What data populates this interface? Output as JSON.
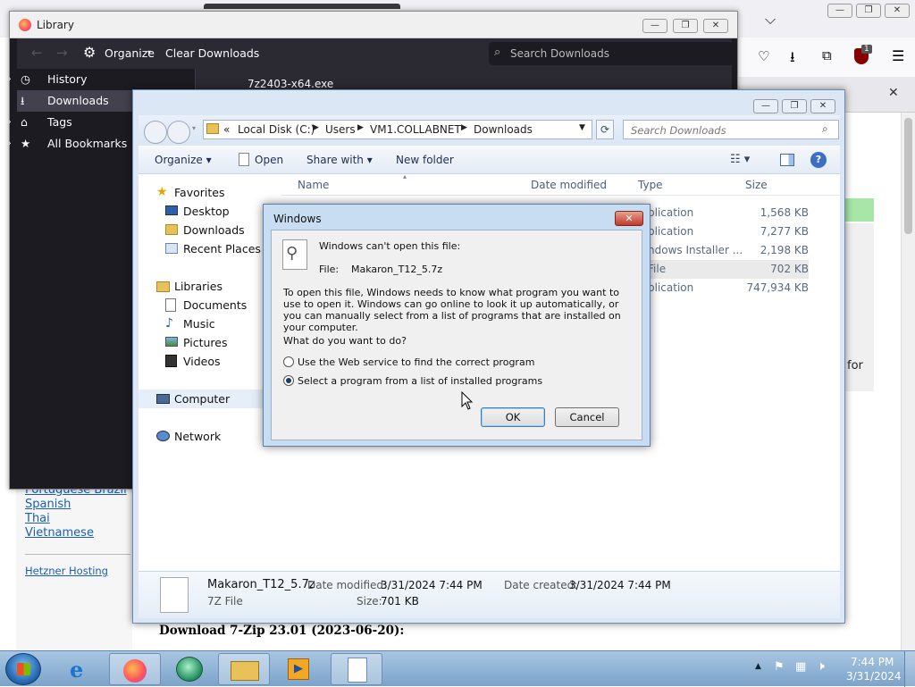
{
  "firefox": {
    "page_links": [
      "Portuguese Brazil",
      "Spanish",
      "Thai",
      "Vietnamese"
    ],
    "hosting_link": "Hetzner Hosting",
    "download_heading": "Download 7-Zip 23.01 (2023-06-20):",
    "badge_count": "1",
    "for_text": "for",
    "close_glyph": "✕"
  },
  "library": {
    "title": "Library",
    "toolbar": {
      "organize": "Organize",
      "clear": "Clear Downloads",
      "search_placeholder": "Search Downloads"
    },
    "sidebar": [
      "History",
      "Downloads",
      "Tags",
      "All Bookmarks"
    ],
    "first_download": "7z2403-x64.exe"
  },
  "explorer": {
    "breadcrumb": [
      "Local Disk (C:)",
      "Users",
      "VM1.COLLABNET",
      "Downloads"
    ],
    "crumb_prefix": "«",
    "search_placeholder": "Search Downloads",
    "commands": {
      "organize": "Organize",
      "open": "Open",
      "share": "Share with",
      "newfolder": "New folder"
    },
    "nav": {
      "favorites": "Favorites",
      "favorites_items": [
        "Desktop",
        "Downloads",
        "Recent Places"
      ],
      "libraries": "Libraries",
      "libraries_items": [
        "Documents",
        "Music",
        "Pictures",
        "Videos"
      ],
      "computer": "Computer",
      "network": "Network"
    },
    "columns": [
      "Name",
      "Date modified",
      "Type",
      "Size"
    ],
    "rows": [
      {
        "type": "plication",
        "size": "1,568 KB"
      },
      {
        "type": "plication",
        "size": "7,277 KB"
      },
      {
        "type": "ndows Installer ...",
        "size": "2,198 KB"
      },
      {
        "type": "File",
        "size": "702 KB"
      },
      {
        "type": "plication",
        "size": "747,934 KB"
      }
    ],
    "details": {
      "filename": "Makaron_T12_5.7z",
      "filetype": "7Z File",
      "modified_label": "Date modified:",
      "modified": "3/31/2024 7:44 PM",
      "created_label": "Date created:",
      "created": "3/31/2024 7:44 PM",
      "size_label": "Size:",
      "size": "701 KB"
    }
  },
  "dialog": {
    "title": "Windows",
    "heading": "Windows can't open this file:",
    "file_label": "File:",
    "file_name": "Makaron_T12_5.7z",
    "explain": "To open this file, Windows needs to know what program you want to use to open it. Windows can go online to look it up automatically, or you can manually select from a list of programs that are installed on your computer.",
    "question": "What do you want to do?",
    "option_web": "Use the Web service to find the correct program",
    "option_list": "Select a program from a list of installed programs",
    "selected": "list",
    "ok": "OK",
    "cancel": "Cancel"
  },
  "taskbar": {
    "time": "7:44 PM",
    "date": "3/31/2024"
  }
}
